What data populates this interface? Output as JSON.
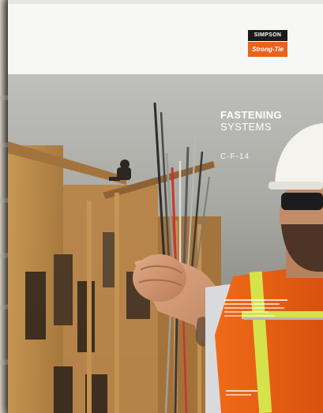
{
  "brand": {
    "name_top": "SIMPSON",
    "name_bottom": "Strong-Tie",
    "logo_colors": {
      "top": "#1b1b1b",
      "bottom": "#e8631c"
    }
  },
  "cover": {
    "title_line1": "FASTENING",
    "title_line2": "SYSTEMS",
    "catalog_code": "C-F-14"
  },
  "icons": [
    "simpson-strong-tie-logo",
    "catalog-cover-photo"
  ]
}
